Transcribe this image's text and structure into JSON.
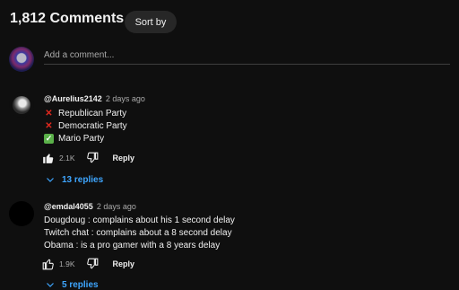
{
  "header": {
    "comment_count": "1,812 Comments",
    "sort_label": "Sort by"
  },
  "composer": {
    "placeholder": "Add a comment..."
  },
  "comments": [
    {
      "author": "@Aurelius2142",
      "time": "2 days ago",
      "lines": [
        {
          "mark": "cross-mark-icon",
          "text": "Republican Party"
        },
        {
          "mark": "cross-mark-icon",
          "text": "Democratic Party"
        },
        {
          "mark": "check-mark-icon",
          "text": "Mario Party"
        }
      ],
      "likes": "2.1K",
      "reply_label": "Reply",
      "replies_label": "13 replies"
    },
    {
      "author": "@emdal4055",
      "time": "2 days ago",
      "lines": [
        {
          "text": "Dougdoug : complains about his 1 second delay"
        },
        {
          "text": "Twitch chat : complains about a 8 second delay"
        },
        {
          "text": "Obama : is a pro gamer with a 8 years delay"
        }
      ],
      "likes": "1.9K",
      "reply_label": "Reply",
      "replies_label": "5 replies"
    }
  ],
  "colors": {
    "background": "#0f0f0f",
    "text": "#f1f1f1",
    "muted": "#aaaaaa",
    "link": "#3ea6ff",
    "cross": "#e0281e",
    "check": "#5bb14a"
  }
}
